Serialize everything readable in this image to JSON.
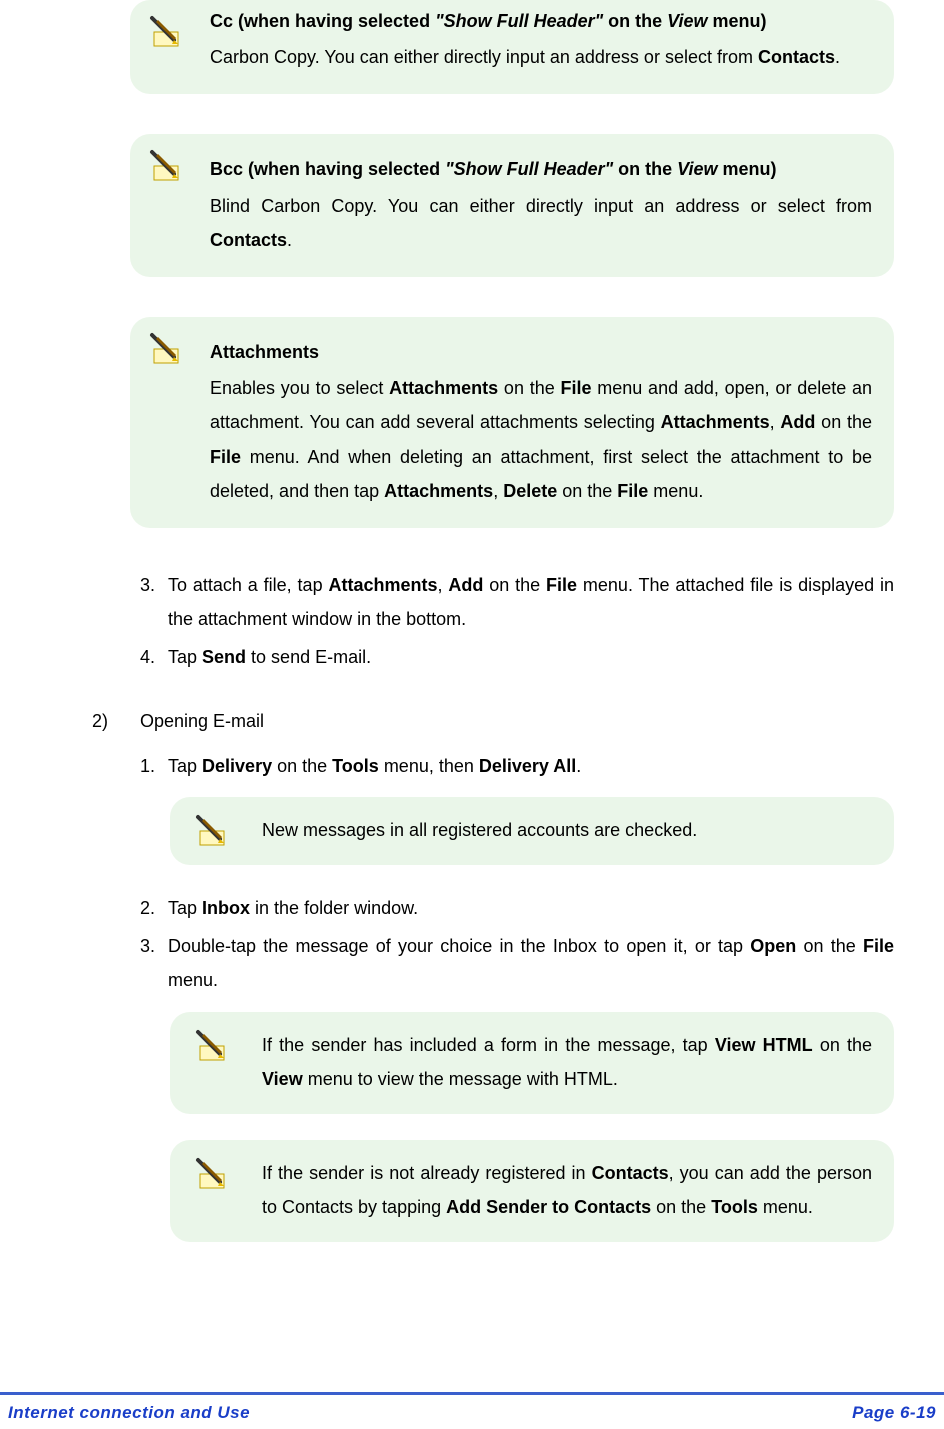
{
  "notes": {
    "cc": {
      "title_pre": "Cc (when having selected ",
      "title_em": "\"Show Full Header\"",
      "title_mid": " on the ",
      "title_em2": "View",
      "title_post": " menu)",
      "body_pre": "Carbon Copy. You can either directly input an address or select from ",
      "body_b1": "Contacts",
      "body_post": "."
    },
    "bcc": {
      "title_pre": "Bcc (when having selected ",
      "title_em": "\"Show Full Header\"",
      "title_mid": " on the ",
      "title_em2": "View",
      "title_post": " menu)",
      "body_pre": "Blind Carbon Copy. You can either directly input an address or select from ",
      "body_b1": "Contacts",
      "body_post": "."
    },
    "attach": {
      "title": "Attachments",
      "p1": "Enables you to select ",
      "p1_b1": "Attachments",
      "p2": " on the ",
      "p2_b1": "File",
      "p3": " menu and add, open, or delete an attachment. You can add several attachments selecting ",
      "p3_b1": "Attachments",
      "p4": ", ",
      "p4_b1": "Add",
      "p5": " on the ",
      "p5_b1": "File",
      "p6": " menu. And when deleting an attachment, first select the attachment to be deleted, and then tap ",
      "p6_b1": "Attachments",
      "p7": ", ",
      "p7_b1": "Delete",
      "p8": " on the ",
      "p8_b1": "File",
      "p9": " menu."
    }
  },
  "list1": {
    "i3_marker": "3.",
    "i3_t1": "To attach a file, tap ",
    "i3_b1": "Attachments",
    "i3_t2": ", ",
    "i3_b2": "Add",
    "i3_t3": " on the ",
    "i3_b3": "File",
    "i3_t4": " menu. The attached file is displayed in the attachment window in the bottom.",
    "i4_marker": "4.",
    "i4_t1": "Tap ",
    "i4_b1": "Send",
    "i4_t2": " to send E-mail."
  },
  "section2": {
    "marker": "2)",
    "title": "Opening E-mail"
  },
  "list2": {
    "i1_marker": "1.",
    "i1_t1": "Tap ",
    "i1_b1": "Delivery",
    "i1_t2": " on the ",
    "i1_b2": "Tools",
    "i1_t3": " menu, then ",
    "i1_b3": "Delivery All",
    "i1_t4": ".",
    "note1": "New messages in all registered accounts are checked.",
    "i2_marker": "2.",
    "i2_t1": "Tap ",
    "i2_b1": "Inbox",
    "i2_t2": " in the folder window.",
    "i3_marker": "3.",
    "i3_t1": "Double-tap the message of your choice in the Inbox to open it, or tap ",
    "i3_b1": "Open",
    "i3_t2": " on the ",
    "i3_b2": "File",
    "i3_t3": " menu.",
    "note2_t1": "If the sender has included a form in the message, tap ",
    "note2_b1": "View HTML",
    "note2_t2": " on the ",
    "note2_b2": "View",
    "note2_t3": " menu to view the message with HTML.",
    "note3_t1": "If the sender is not already registered in ",
    "note3_b1": "Contacts",
    "note3_t2": ", you can add the person to Contacts by tapping ",
    "note3_b2": "Add Sender to Contacts",
    "note3_t3": " on the ",
    "note3_b3": "Tools",
    "note3_t4": " menu."
  },
  "footer": {
    "left": "Internet connection and Use",
    "right": "Page 6-19"
  }
}
